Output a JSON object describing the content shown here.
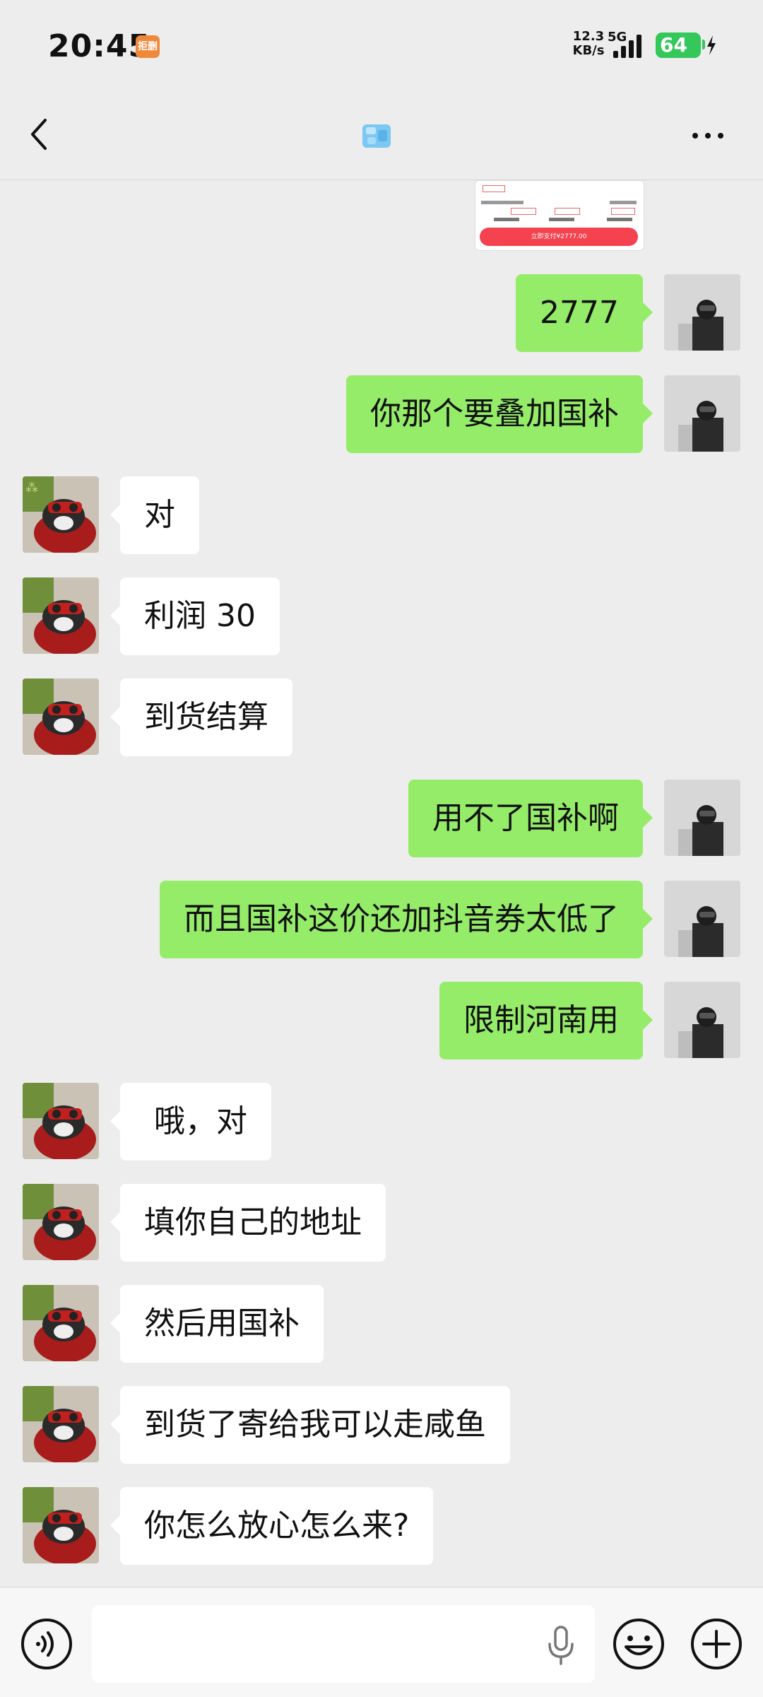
{
  "status_bar": {
    "time": "20:45",
    "app_badge": "拒删",
    "net_speed_value": "12.3",
    "net_speed_unit": "KB/s",
    "network": "5G",
    "battery": "64",
    "battery_color": "#34c759"
  },
  "header": {
    "back_icon": "chevron-left-icon",
    "title_icon": "ice-cube-emoji",
    "more_icon": "more-dots-icon"
  },
  "colors": {
    "outgoing_bubble": "#95ec69",
    "incoming_bubble": "#ffffff",
    "background": "#ededed"
  },
  "preview_card": {
    "pay_label": "立即支付¥2777.00"
  },
  "messages": [
    {
      "side": "out",
      "text": "2777"
    },
    {
      "side": "out",
      "text": "你那个要叠加国补"
    },
    {
      "side": "in",
      "text": "对"
    },
    {
      "side": "in",
      "text": "利润 30"
    },
    {
      "side": "in",
      "text": "到货结算"
    },
    {
      "side": "out",
      "text": "用不了国补啊"
    },
    {
      "side": "out",
      "text": "而且国补这价还加抖音券太低了"
    },
    {
      "side": "out",
      "text": "限制河南用"
    },
    {
      "side": "in",
      "text": " 哦，对"
    },
    {
      "side": "in",
      "text": "填你自己的地址"
    },
    {
      "side": "in",
      "text": "然后用国补"
    },
    {
      "side": "in",
      "text": "到货了寄给我可以走咸鱼"
    },
    {
      "side": "in",
      "text": "你怎么放心怎么来?"
    }
  ],
  "input_bar": {
    "value": "",
    "voice_icon": "voice-icon",
    "mic_icon": "microphone-icon",
    "emoji_icon": "emoji-icon",
    "plus_icon": "plus-icon"
  }
}
